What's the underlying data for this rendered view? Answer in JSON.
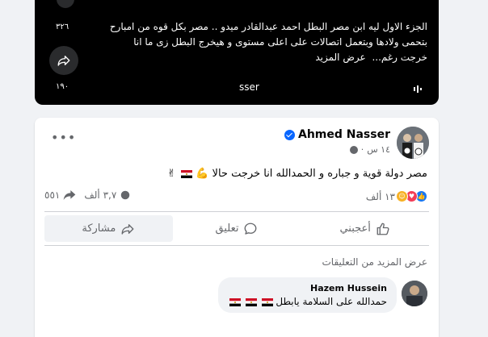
{
  "reel": {
    "text": "الجزء الاول ليه ابن مصر البطل احمد عبدالقادر ميدو .. مصر بكل قوه من امبارح بتحمى ولادها وبتعمل اتصالات على اعلى مستوى و هيخرج البطل زى ما انا خرجت رغم...",
    "see_more": "عرض المزيد",
    "top_count": "٣٢٦",
    "bottom_count": "١٩٠",
    "sound_label": "sser"
  },
  "post": {
    "author": "Ahmed Nasser",
    "time": "١٤ س",
    "text": "مصر دولة قوية و جباره و الحمدالله انا خرجت حالا",
    "reactions_count": "١٣ ألف",
    "comments_count": "٣,٧ ألف",
    "shares_count": "٥٥١",
    "actions": {
      "like": "أعجبني",
      "comment": "تعليق",
      "share": "مشاركة"
    },
    "more_comments": "عرض المزيد من التعليقات",
    "comment": {
      "author": "Hazem Hussein",
      "text": "حمدالله على السلامة يابطل"
    }
  },
  "colors": {
    "accent": "#0866ff",
    "like": "#1877f2",
    "love": "#f33e58",
    "care": "#f7b125",
    "muted_text": "#65676b",
    "background": "#f0f2f5"
  },
  "icons": {
    "share": "share-arrow-icon",
    "like": "thumbs-up-icon",
    "comment": "comment-bubble-icon",
    "verified": "verified-badge-icon",
    "globe": "globe-icon",
    "more": "more-dots-icon"
  }
}
